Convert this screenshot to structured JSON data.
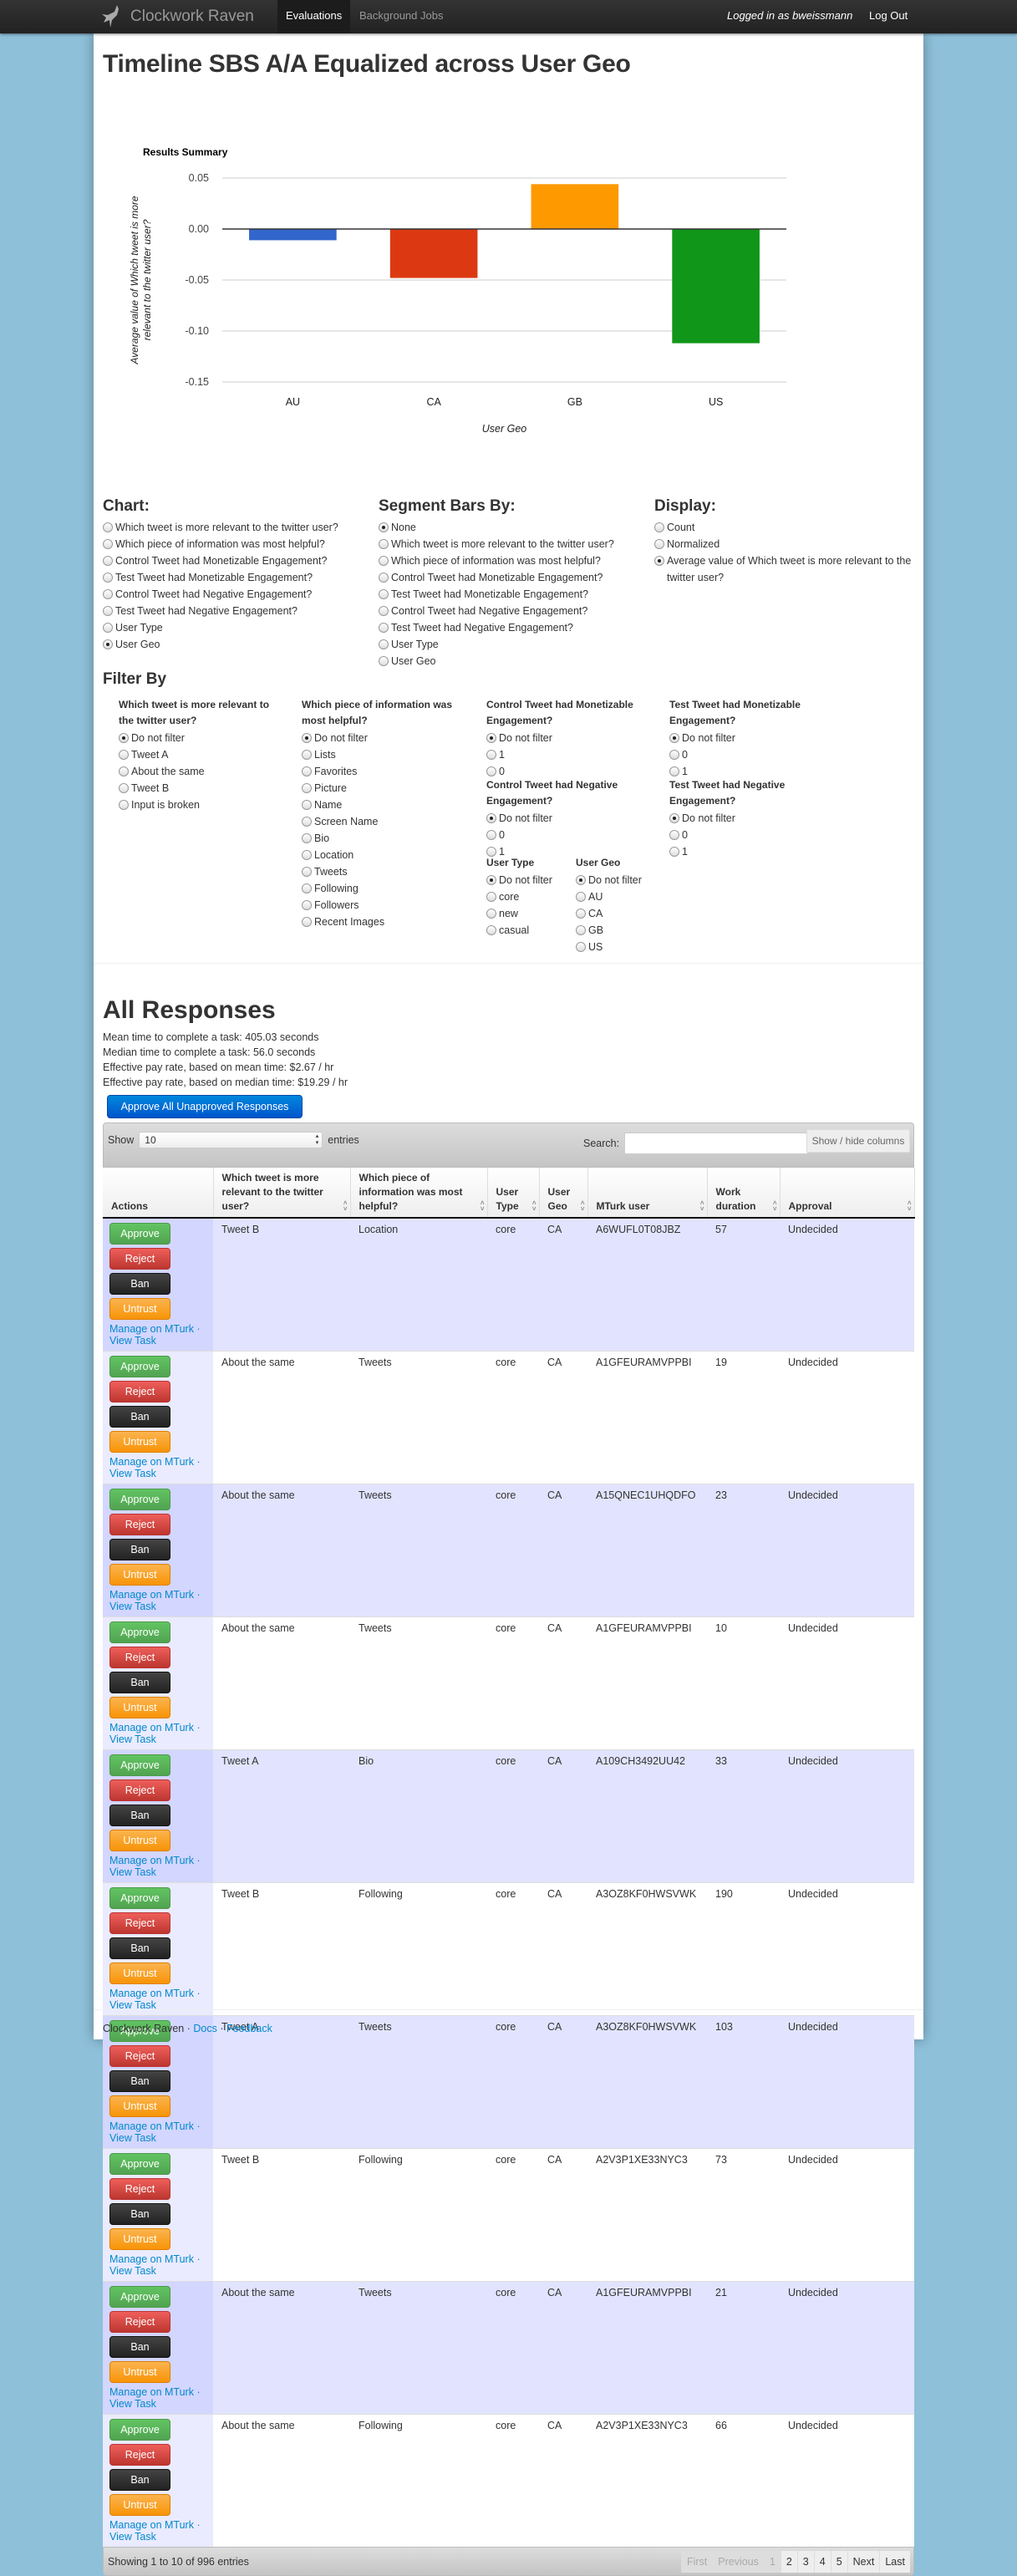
{
  "nav": {
    "brand": "Clockwork Raven",
    "items": [
      "Evaluations",
      "Background Jobs"
    ],
    "logged_in": "Logged in as bweissmann",
    "logout": "Log Out"
  },
  "page_title": "Timeline SBS A/A Equalized across User Geo",
  "chart_data": {
    "type": "bar",
    "title": "Results Summary",
    "categories": [
      "AU",
      "CA",
      "GB",
      "US"
    ],
    "values": [
      -0.011,
      -0.048,
      0.044,
      -0.112
    ],
    "colors": [
      "#3366cc",
      "#dc3912",
      "#ff9900",
      "#109618"
    ],
    "xlabel": "User Geo",
    "ylabel": "Average value of Which tweet is more relevant to the twitter user?",
    "ylim": [
      -0.15,
      0.05
    ],
    "yticks": [
      "0.05",
      "0.00",
      "-0.05",
      "-0.10",
      "-0.15"
    ],
    "grid": true,
    "legend": "none"
  },
  "options": {
    "chart": {
      "heading": "Chart:",
      "items": [
        "Which tweet is more relevant to the twitter user?",
        "Which piece of information was most helpful?",
        "Control Tweet had Monetizable Engagement?",
        "Test Tweet had Monetizable Engagement?",
        "Control Tweet had Negative Engagement?",
        "Test Tweet had Negative Engagement?",
        "User Type",
        "User Geo"
      ],
      "selected": 7
    },
    "segment": {
      "heading": "Segment Bars By:",
      "items": [
        "None",
        "Which tweet is more relevant to the twitter user?",
        "Which piece of information was most helpful?",
        "Control Tweet had Monetizable Engagement?",
        "Test Tweet had Monetizable Engagement?",
        "Control Tweet had Negative Engagement?",
        "Test Tweet had Negative Engagement?",
        "User Type",
        "User Geo"
      ],
      "selected": 0
    },
    "display": {
      "heading": "Display:",
      "items": [
        "Count",
        "Normalized",
        "Average value of Which tweet is more relevant to the twitter user?"
      ],
      "selected": 2
    }
  },
  "filter": {
    "heading": "Filter By",
    "groups": [
      {
        "title": "Which tweet is more relevant to the twitter user?",
        "items": [
          "Do not filter",
          "Tweet A",
          "About the same",
          "Tweet B",
          "Input is broken"
        ]
      },
      {
        "title": "Which piece of information was most helpful?",
        "items": [
          "Do not filter",
          "Lists",
          "Favorites",
          "Picture",
          "Name",
          "Screen Name",
          "Bio",
          "Location",
          "Tweets",
          "Following",
          "Followers",
          "Recent Images"
        ]
      },
      {
        "title": "Control Tweet had Monetizable Engagement?",
        "items": [
          "Do not filter",
          "1",
          "0"
        ]
      },
      {
        "title": "Control Tweet had Negative Engagement?",
        "items": [
          "Do not filter",
          "0",
          "1"
        ]
      },
      {
        "title": "User Type",
        "items": [
          "Do not filter",
          "core",
          "new",
          "casual"
        ]
      },
      {
        "title": "User Geo",
        "items": [
          "Do not filter",
          "AU",
          "CA",
          "GB",
          "US"
        ]
      },
      {
        "title": "Test Tweet had Monetizable Engagement?",
        "items": [
          "Do not filter",
          "0",
          "1"
        ]
      },
      {
        "title": "Test Tweet had Negative Engagement?",
        "items": [
          "Do not filter",
          "0",
          "1"
        ]
      }
    ]
  },
  "responses": {
    "heading": "All Responses",
    "stats": [
      "Mean time to complete a task: 405.03 seconds",
      "Median time to complete a task: 56.0 seconds",
      "Effective pay rate, based on mean time: $2.67 / hr",
      "Effective pay rate, based on median time: $19.29 / hr"
    ],
    "approve_all": "Approve All Unapproved Responses",
    "show_label": "Show",
    "show_value": "10",
    "entries_label": "entries",
    "search_label": "Search:",
    "search_value": "",
    "columns_button": "Show / hide columns",
    "columns": [
      "Actions",
      "Which tweet is more relevant to the twitter user?",
      "Which piece of information was most helpful?",
      "User Type",
      "User Geo",
      "MTurk user",
      "Work duration",
      "Approval"
    ],
    "actions": {
      "approve": "Approve",
      "reject": "Reject",
      "ban": "Ban",
      "untrust": "Untrust",
      "manage": "Manage on MTurk",
      "sep": " · ",
      "view": "View Task"
    },
    "rows": [
      [
        "Tweet B",
        "Location",
        "core",
        "CA",
        "A6WUFL0T08JBZ",
        "57",
        "Undecided"
      ],
      [
        "About the same",
        "Tweets",
        "core",
        "CA",
        "A1GFEURAMVPPBI",
        "19",
        "Undecided"
      ],
      [
        "About the same",
        "Tweets",
        "core",
        "CA",
        "A15QNEC1UHQDFO",
        "23",
        "Undecided"
      ],
      [
        "About the same",
        "Tweets",
        "core",
        "CA",
        "A1GFEURAMVPPBI",
        "10",
        "Undecided"
      ],
      [
        "Tweet A",
        "Bio",
        "core",
        "CA",
        "A109CH3492UU42",
        "33",
        "Undecided"
      ],
      [
        "Tweet B",
        "Following",
        "core",
        "CA",
        "A3OZ8KF0HWSVWK",
        "190",
        "Undecided"
      ],
      [
        "Tweet A",
        "Tweets",
        "core",
        "CA",
        "A3OZ8KF0HWSVWK",
        "103",
        "Undecided"
      ],
      [
        "Tweet B",
        "Following",
        "core",
        "CA",
        "A2V3P1XE33NYC3",
        "73",
        "Undecided"
      ],
      [
        "About the same",
        "Tweets",
        "core",
        "CA",
        "A1GFEURAMVPPBI",
        "21",
        "Undecided"
      ],
      [
        "About the same",
        "Following",
        "core",
        "CA",
        "A2V3P1XE33NYC3",
        "66",
        "Undecided"
      ]
    ],
    "info": "Showing 1 to 10 of 996 entries",
    "pager": [
      "First",
      "Previous",
      "1",
      "2",
      "3",
      "4",
      "5",
      "Next",
      "Last"
    ],
    "pager_disabled": [
      "First",
      "Previous",
      "1"
    ]
  },
  "footer": {
    "brand": "Clockwork Raven",
    "sep": " · ",
    "links": [
      "Docs",
      "Feedback"
    ]
  }
}
